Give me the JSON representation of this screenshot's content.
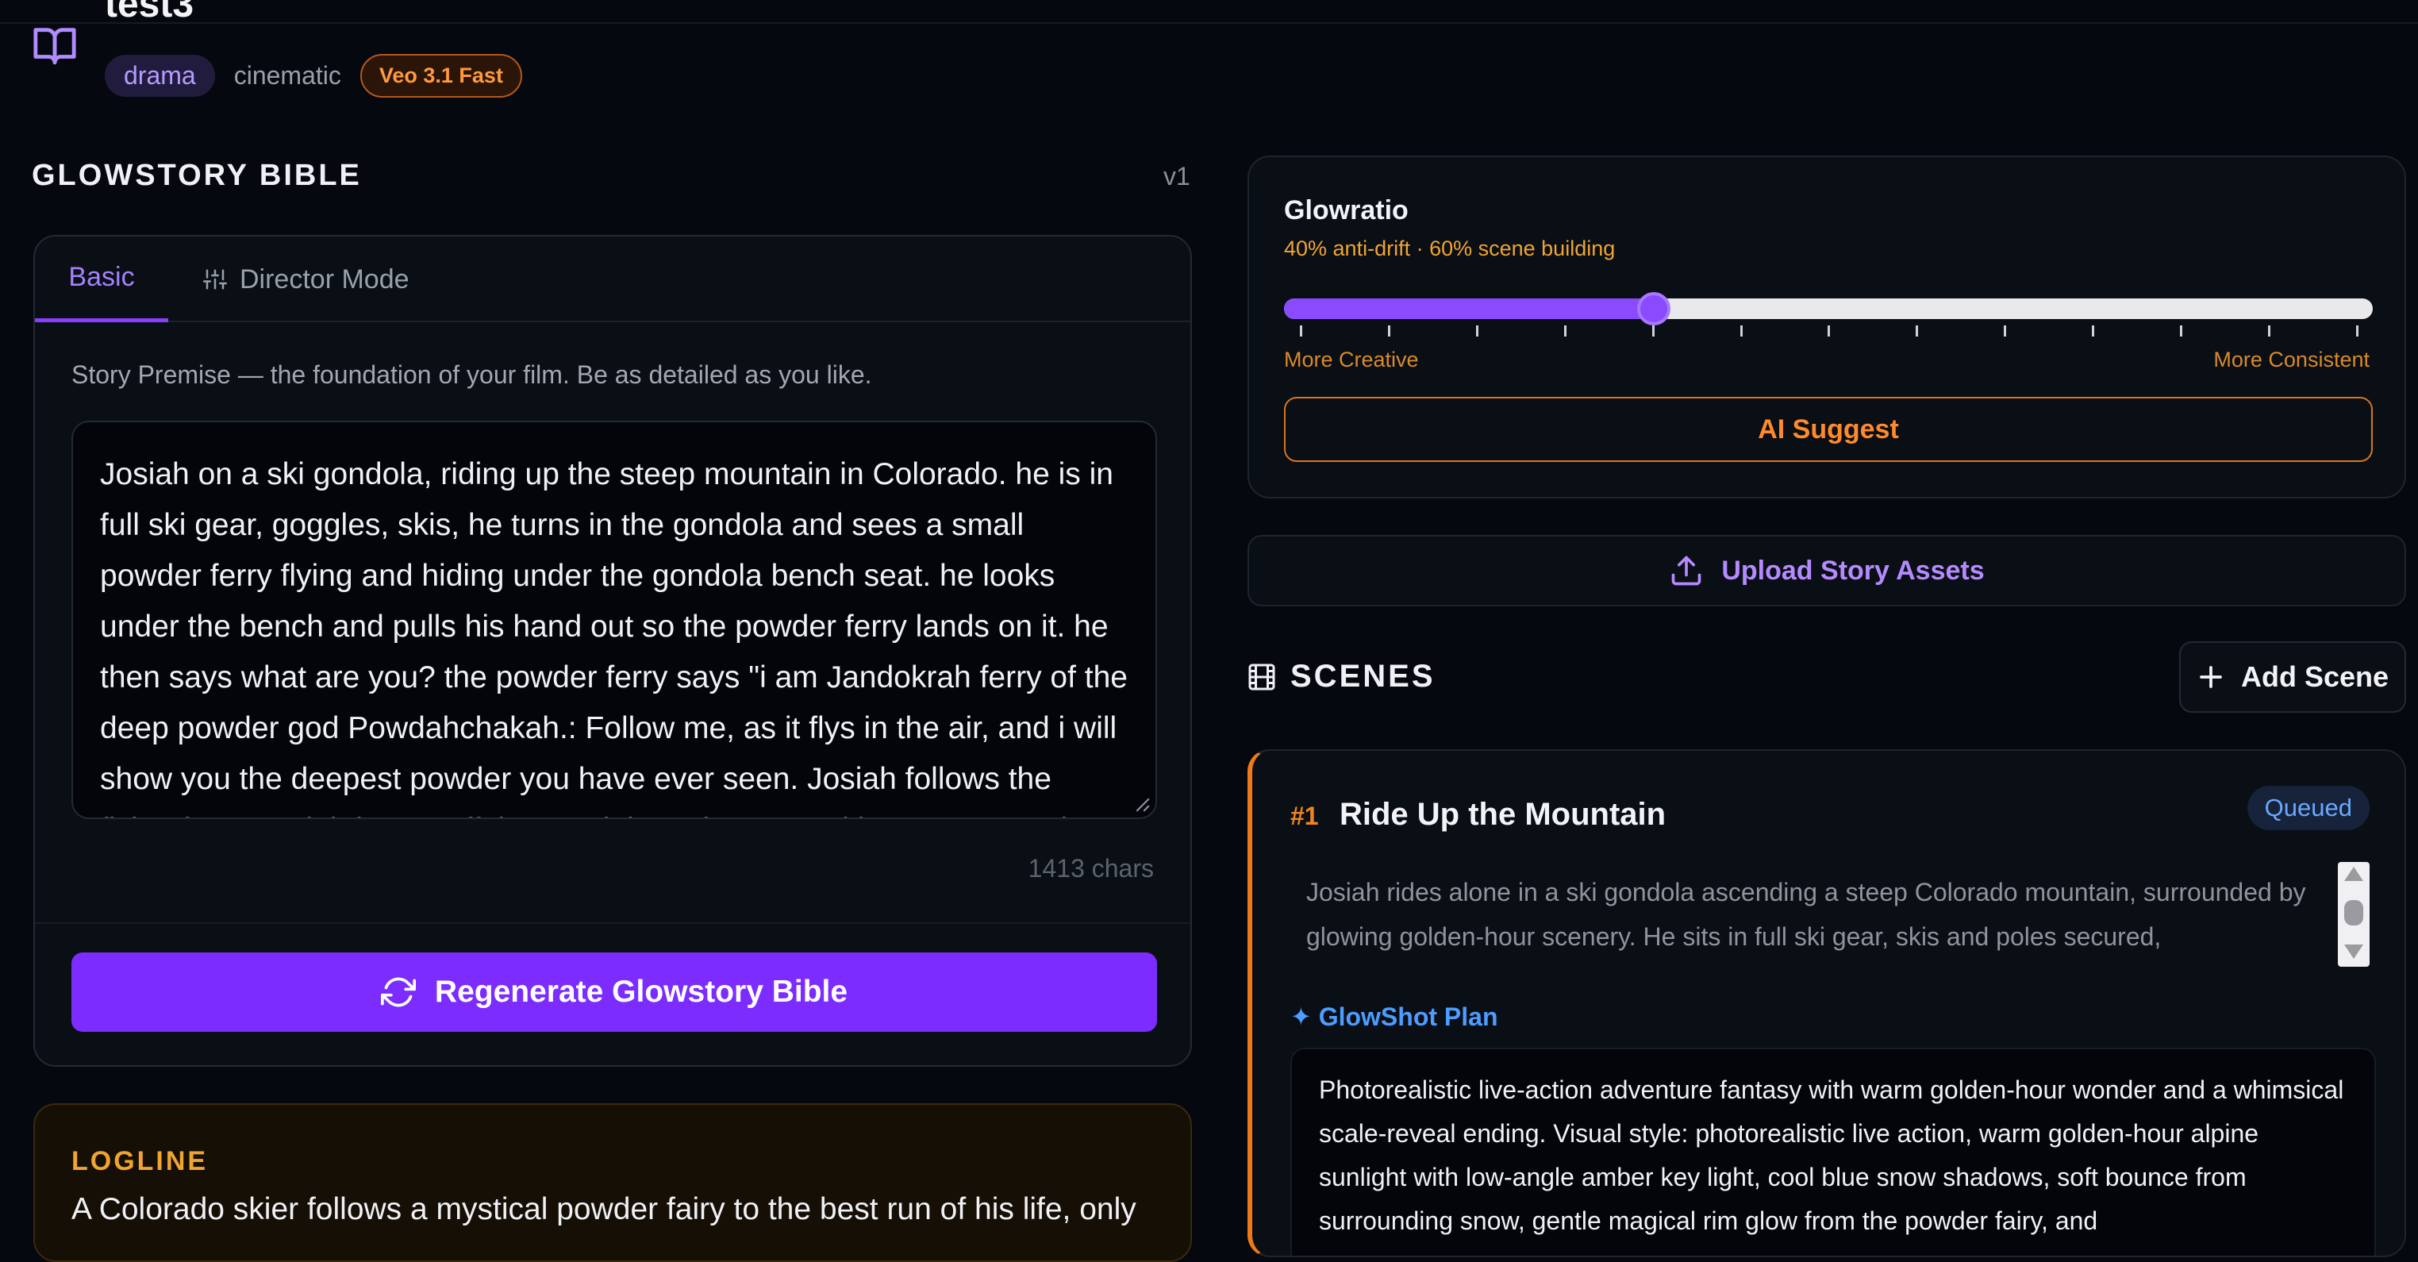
{
  "project": {
    "title": "test3",
    "tags": [
      "drama",
      "cinematic"
    ],
    "model_badge": "Veo 3.1 Fast"
  },
  "bible": {
    "heading": "GLOWSTORY BIBLE",
    "version": "v1",
    "tabs": {
      "basic": "Basic",
      "director": "Director Mode"
    },
    "premise_label": "Story Premise — the foundation of your film. Be as detailed as you like.",
    "premise_text": "Josiah on a ski gondola, riding up the steep mountain in Colorado. he is in full ski gear, goggles, skis, he turns in the gondola and sees a small powder ferry flying and hiding under the gondola bench seat. he looks under the bench and pulls his hand out so the powder ferry lands on it. he then says what are you? the powder ferry says \"i am Jandokrah ferry of the deep powder god Powdahchakah.:  Follow me, as it flys in the air, and i will show you the deepest powder you have ever seen.  Josiah follows the flying ferry. Josiah jumps off the gondola at the top and he sees a magic",
    "char_count": "1413 chars",
    "regenerate_label": "Regenerate Glowstory Bible"
  },
  "logline": {
    "label": "LOGLINE",
    "text": "A Colorado skier follows a mystical powder fairy to the best run of his life, only"
  },
  "glowratio": {
    "title": "Glowratio",
    "subtitle": "40% anti-drift · 60% scene building",
    "value_fraction": 0.34,
    "tick_count": 13,
    "left_label": "More Creative",
    "right_label": "More Consistent",
    "suggest_label": "AI Suggest"
  },
  "upload": {
    "label": "Upload Story Assets"
  },
  "scenes": {
    "heading": "SCENES",
    "add_label": "Add Scene",
    "items": [
      {
        "number": "#1",
        "title": "Ride Up the Mountain",
        "status": "Queued",
        "description": "Josiah rides alone in a ski gondola ascending a steep Colorado mountain, surrounded by glowing golden-hour scenery. He sits in full ski gear, skis and poles secured,",
        "plan_label": "✦ GlowShot Plan",
        "plan_text": "Photorealistic live-action adventure fantasy with warm golden-hour wonder and a whimsical scale-reveal ending. Visual style: photorealistic live action, warm golden-hour alpine sunlight with low-angle amber key light, cool blue snow shadows, soft bounce from surrounding snow, gentle magical rim glow from the powder fairy, and"
      }
    ]
  },
  "colors": {
    "accent_purple": "#7c2cff",
    "accent_orange": "#f07a1a",
    "status_blue": "#6aa8ff",
    "background": "#05080e"
  },
  "icons": {
    "book": "book-icon",
    "sliders": "sliders-icon",
    "refresh": "refresh-icon",
    "upload": "upload-icon",
    "film": "film-icon",
    "plus": "plus-icon"
  }
}
